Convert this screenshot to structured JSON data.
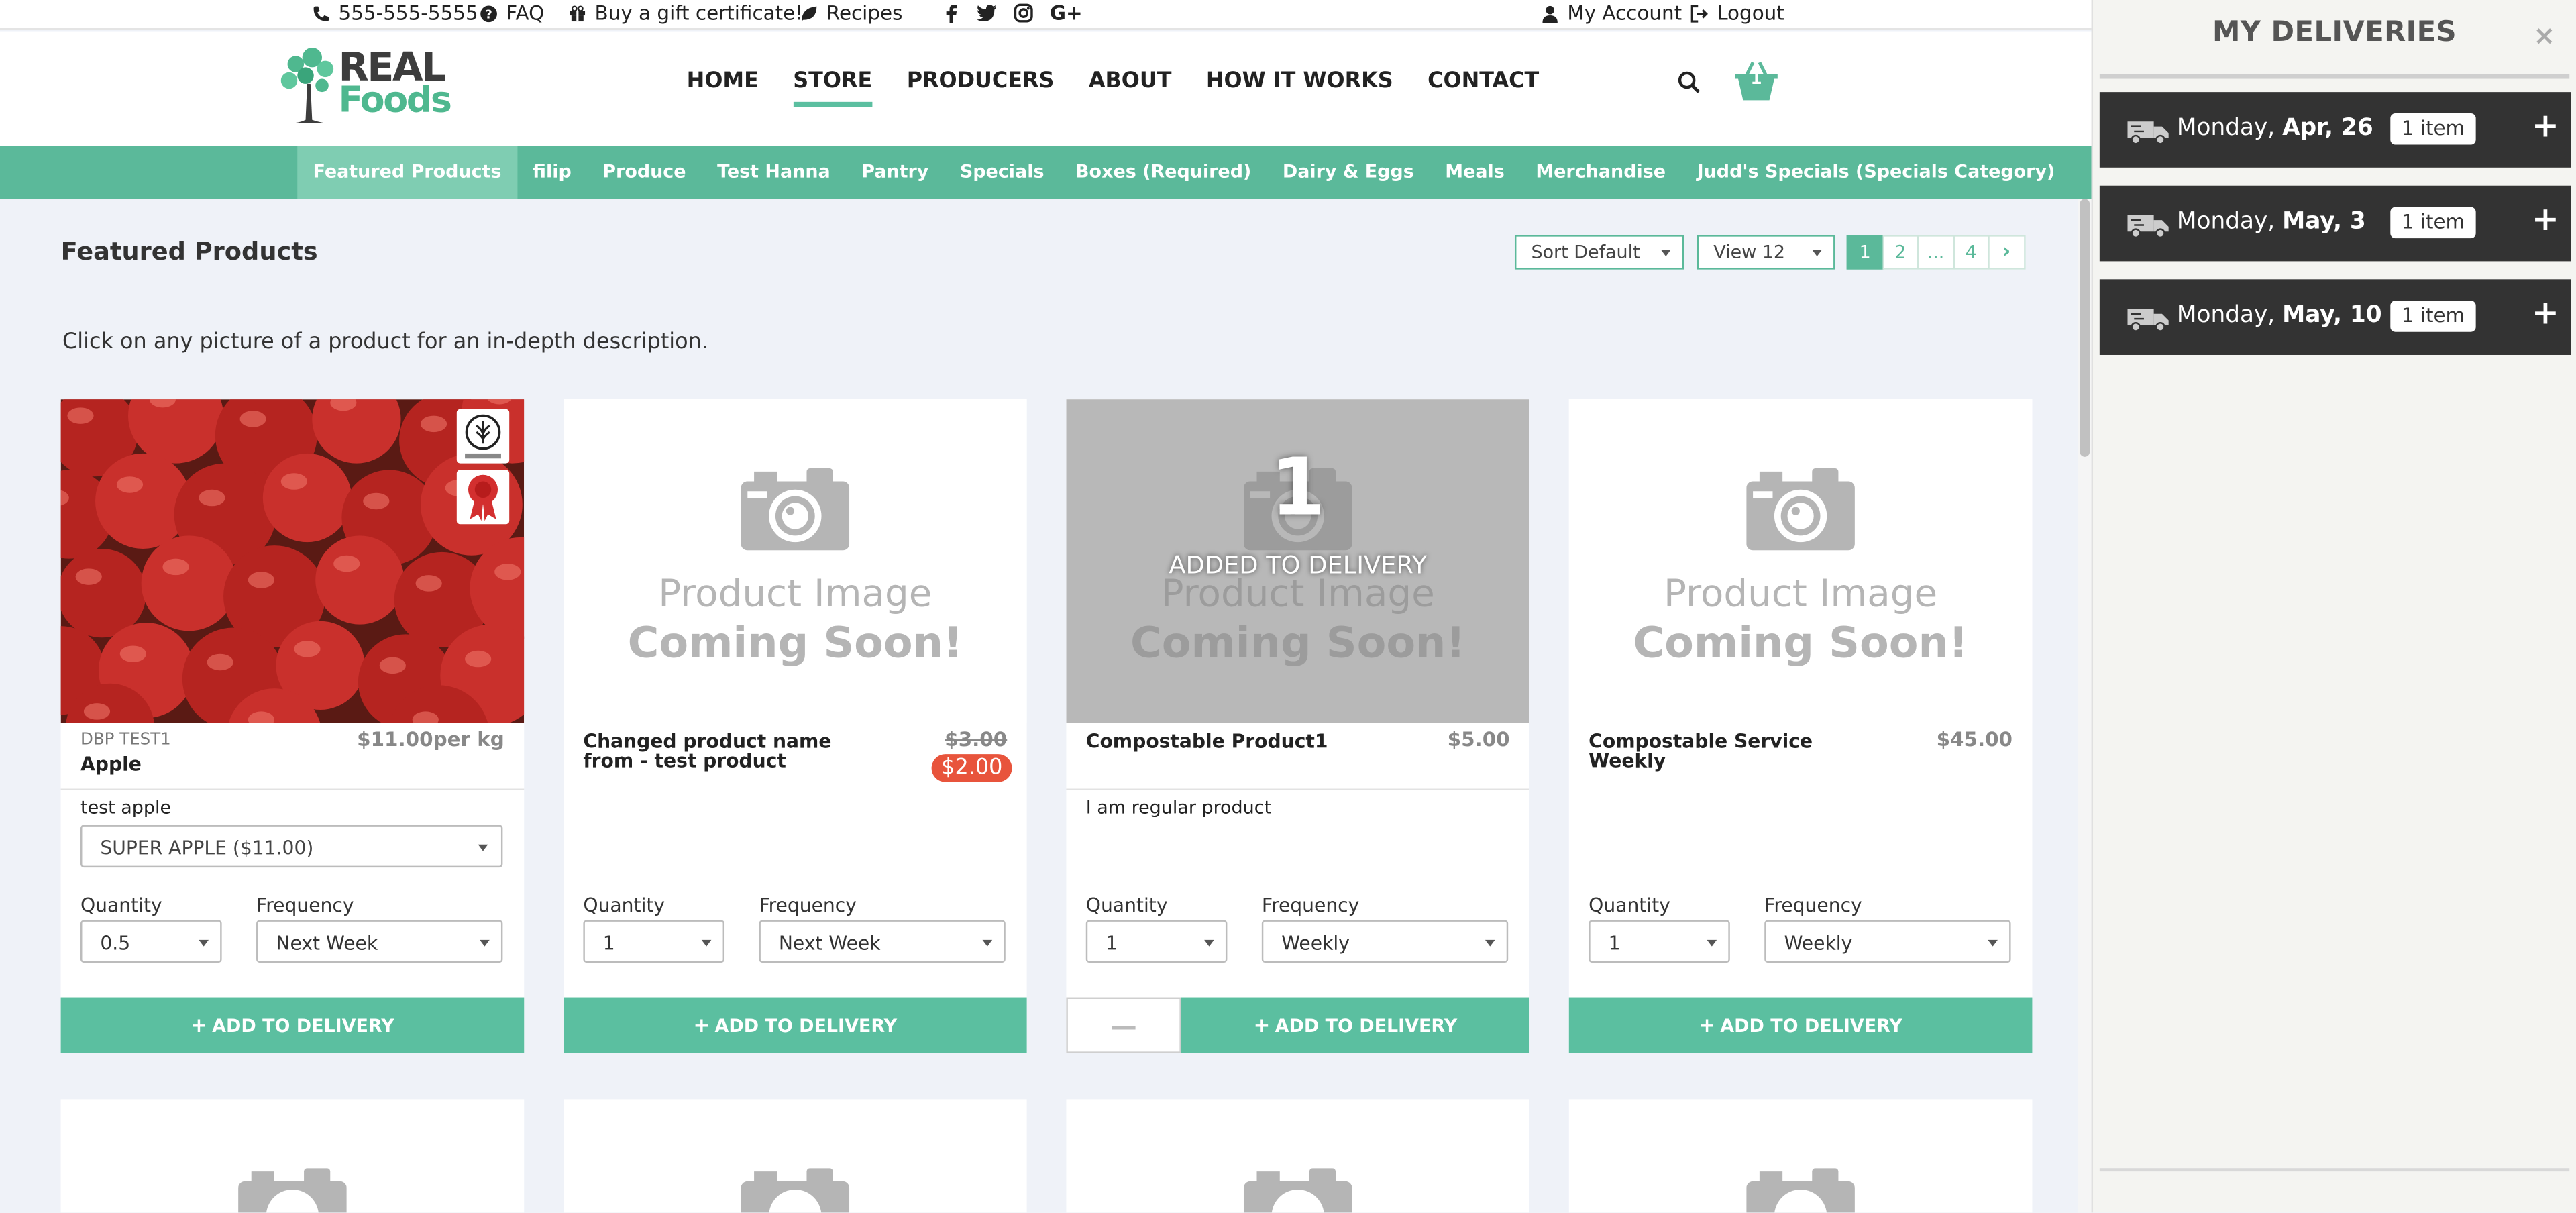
{
  "topbar": {
    "phone": "555-555-5555",
    "faq": "FAQ",
    "gift": "Buy a gift certificate!",
    "recipes": "Recipes",
    "social": [
      "f",
      "t",
      "ig",
      "G+"
    ],
    "account": "My Account",
    "logout": "Logout"
  },
  "logo": {
    "line1": "REAL",
    "line2": "Foods"
  },
  "nav": [
    "HOME",
    "STORE",
    "PRODUCERS",
    "ABOUT",
    "HOW IT WORKS",
    "CONTACT"
  ],
  "nav_active": "STORE",
  "cart": {
    "count": "1"
  },
  "categories": [
    "Featured Products",
    "filip",
    "Produce",
    "Test Hanna",
    "Pantry",
    "Specials",
    "Boxes (Required)",
    "Dairy & Eggs",
    "Meals",
    "Merchandise",
    "Judd's Specials (Specials Category)"
  ],
  "page": {
    "title": "Featured Products",
    "intro": "Click on any picture of a product for an in-depth description.",
    "sort": "Sort Default",
    "view": "View 12",
    "pages": [
      "1",
      "2",
      "...",
      "4",
      "›"
    ]
  },
  "placeholder": {
    "line1": "Product Image",
    "line2": "Coming Soon!"
  },
  "labels": {
    "quantity": "Quantity",
    "frequency": "Frequency",
    "add": "ADD TO DELIVERY",
    "added": "ADDED TO DELIVERY",
    "added_count": "1"
  },
  "products": [
    {
      "sku": "DBP TEST1",
      "name": "Apple",
      "price": "$11.00per kg",
      "desc": "test apple",
      "variant": "SUPER APPLE ($11.00)",
      "qty": "0.5",
      "freq": "Next Week"
    },
    {
      "name": "Changed product name from - test product",
      "price": "$3.00",
      "sale": "$2.00",
      "qty": "1",
      "freq": "Next Week"
    },
    {
      "name": "Compostable Product1",
      "price": "$5.00",
      "desc": "I am regular product",
      "qty": "1",
      "freq": "Weekly"
    },
    {
      "name": "Compostable Service Weekly",
      "price": "$45.00",
      "qty": "1",
      "freq": "Weekly"
    }
  ],
  "panel": {
    "title": "MY DELIVERIES",
    "close": "×",
    "deliveries": [
      {
        "day": "Monday,",
        "date": "Apr, 26",
        "count": "1 item"
      },
      {
        "day": "Monday,",
        "date": "May, 3",
        "count": "1 item"
      },
      {
        "day": "Monday,",
        "date": "May, 10",
        "count": "1 item"
      }
    ]
  },
  "colors": {
    "brand_green": "#5bb99a",
    "sale_red": "#e8543c",
    "panel_dark": "#333333"
  }
}
